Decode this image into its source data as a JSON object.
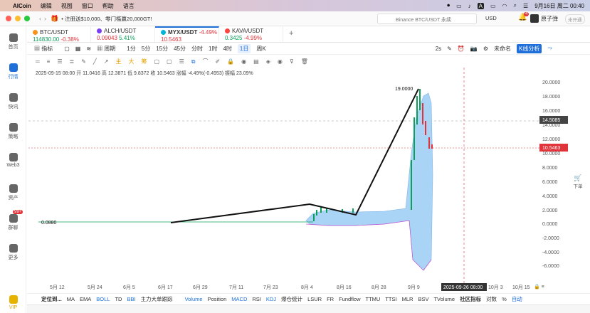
{
  "menubar": {
    "app": "AICoin",
    "items": [
      "编辑",
      "视图",
      "窗口",
      "帮助",
      "语言"
    ],
    "datetime": "9月16日 周二 00:40",
    "input_badge": "A"
  },
  "titlebar": {
    "notice": "• 注册送$10,000、零门槛赢20,000GT!",
    "search_placeholder": "Binance BTC/USDT 永续",
    "currency": "USD",
    "badge": "4",
    "username": "原子弹",
    "vip": "未开通"
  },
  "sidebar": [
    {
      "label": "首页",
      "icon": "home-icon"
    },
    {
      "label": "行情",
      "icon": "chart-icon",
      "active": true
    },
    {
      "label": "快讯",
      "icon": "news-icon"
    },
    {
      "label": "策略",
      "icon": "robot-icon"
    },
    {
      "label": "Web3",
      "icon": "web3-icon"
    },
    {
      "label": "资产",
      "icon": "wallet-icon"
    },
    {
      "label": "群聊",
      "icon": "chat-icon",
      "badge": "99+"
    },
    {
      "label": "更多",
      "icon": "grid-icon"
    },
    {
      "label": "VIP",
      "icon": "vip-icon"
    }
  ],
  "tabs": [
    {
      "name": "BTC/USDT",
      "price": "114830.00",
      "change": "-0.38%",
      "dir": "dn"
    },
    {
      "name": "ALCH/USDT",
      "price": "0.09043",
      "change": "5.41%",
      "dir": "up"
    },
    {
      "name": "MYX/USDT",
      "price": "10.5463",
      "change": "-4.49%",
      "dir": "dn",
      "active": true
    },
    {
      "name": "KAVA/USDT",
      "price": "0.3425",
      "change": "-4.99%",
      "dir": "up"
    }
  ],
  "toolbar": {
    "items": [
      "指标",
      "周期",
      "1分",
      "5分",
      "15分",
      "45分",
      "分时",
      "1时",
      "4时",
      "1日",
      "周K"
    ],
    "active": "1日",
    "refresh": "2s",
    "unnamed": "未命名",
    "kline": "K线分析"
  },
  "drawbar": {
    "labels": [
      "主",
      "大",
      "筹"
    ]
  },
  "info": {
    "text": "2025-09-15 08:00 开 11.0416 高 12.3871 低 9.8372 收 10.5463 涨幅 -4.49%(-0.4953) 振幅 23.09%"
  },
  "chart_data": {
    "type": "candlestick",
    "yaxis": [
      "20.0000",
      "18.0000",
      "16.0000",
      "14.0000",
      "12.0000",
      "10.0000",
      "8.0000",
      "6.0000",
      "4.0000",
      "2.0000",
      "0.0000",
      "-2.0000",
      "-4.0000",
      "-6.0000"
    ],
    "xaxis": [
      "5月 12",
      "5月 24",
      "6月 5",
      "6月 17",
      "6月 29",
      "7月 11",
      "7月 23",
      "8月 4",
      "8月 16",
      "8月 28",
      "9月 9",
      "9月 21",
      "10月 3",
      "10月 15"
    ],
    "crosshair_price": "14.5085",
    "last_price": "10.5463",
    "crosshair_date": "2025-09-26 08:00",
    "high_label": "19.0000",
    "low_label": "0.0880"
  },
  "right_panel": {
    "label": "下单"
  },
  "bottom": {
    "locate": "定位到...",
    "items": [
      "MA",
      "EMA",
      "BOLL",
      "TD",
      "BBI",
      "主力大单跟踪",
      "Volume",
      "Position",
      "MACD",
      "RSI",
      "KDJ",
      "爆仓统计",
      "LSUR",
      "FR",
      "Fundflow",
      "TTMU",
      "TTSI",
      "MLR",
      "BSV",
      "TVolume"
    ],
    "community": "社区指标",
    "log": "对数",
    "pct": "%",
    "auto": "自动"
  }
}
